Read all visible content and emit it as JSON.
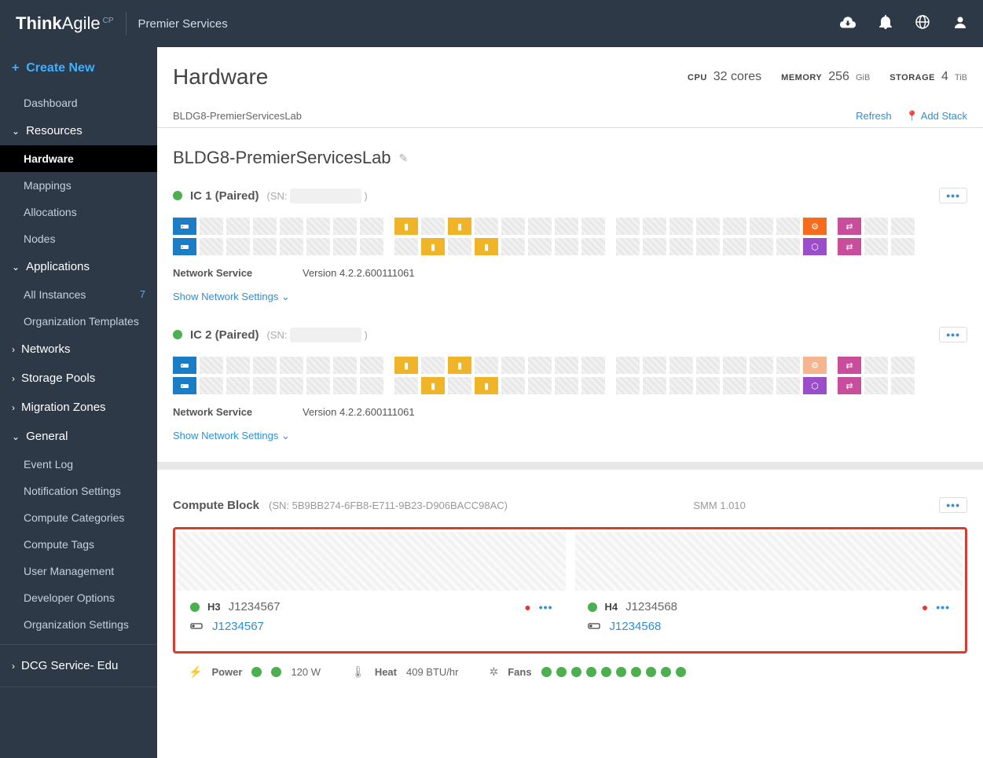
{
  "header": {
    "logo_prefix": "Think",
    "logo_suffix": "Agile",
    "logo_sup": "CP",
    "subtitle": "Premier Services"
  },
  "sidebar": {
    "create": "Create New",
    "dashboard": "Dashboard",
    "resources_h": "Resources",
    "hardware": "Hardware",
    "mappings": "Mappings",
    "allocations": "Allocations",
    "nodes": "Nodes",
    "apps_h": "Applications",
    "all_inst": "All Instances",
    "all_inst_count": "7",
    "org_templates": "Organization Templates",
    "networks": "Networks",
    "storage_pools": "Storage Pools",
    "migration": "Migration Zones",
    "general_h": "General",
    "event_log": "Event Log",
    "notif": "Notification Settings",
    "compute_cat": "Compute Categories",
    "compute_tags": "Compute Tags",
    "user_mgmt": "User Management",
    "dev_opts": "Developer Options",
    "org_settings": "Organization Settings",
    "dcg": "DCG Service- Edu"
  },
  "page": {
    "title": "Hardware",
    "cpu_label": "CPU",
    "cpu_val": "32 cores",
    "mem_label": "MEMORY",
    "mem_val": "256",
    "mem_unit": "GiB",
    "storage_label": "STORAGE",
    "storage_val": "4",
    "storage_unit": "TiB",
    "breadcrumb": "BLDG8-PremierServicesLab",
    "refresh": "Refresh",
    "add_stack": "Add Stack"
  },
  "stack": {
    "name": "BLDG8-PremierServicesLab",
    "ic1_name": "IC 1 (Paired)",
    "ic2_name": "IC 2 (Paired)",
    "sn_prefix": "(SN:",
    "sn_suffix": ")",
    "net_service_label": "Network Service",
    "net_service_val": "Version 4.2.2.600111061",
    "show_net": "Show Network Settings"
  },
  "compute": {
    "title": "Compute Block",
    "sn": "(SN: 5B9BB274-6FB8-E711-9B23-D906BACC98AC)",
    "smm": "SMM 1.010",
    "h3": "H3",
    "h3_serial": "J1234567",
    "h3_link": "J1234567",
    "h4": "H4",
    "h4_serial": "J1234568",
    "h4_link": "J1234568"
  },
  "footer": {
    "power": "Power",
    "power_val": "120 W",
    "heat": "Heat",
    "heat_val": "409 BTU/hr",
    "fans": "Fans"
  }
}
